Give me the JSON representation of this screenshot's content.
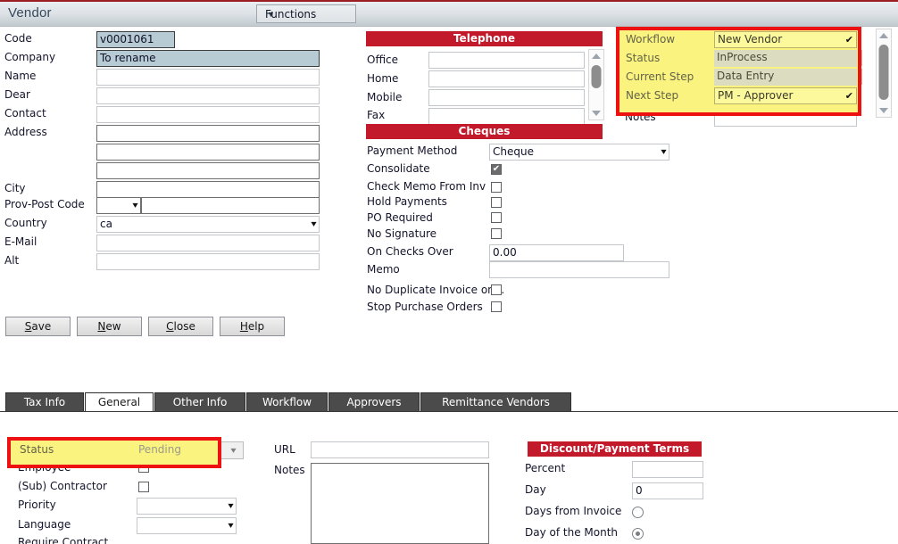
{
  "window": {
    "title": "Vendor",
    "functions_label": "Functions",
    "functions_caret": "▼",
    "accent_red": "#c2192b",
    "highlight_yellow": "#faf37f",
    "highlight_border": "#ee1111"
  },
  "vendor_form": {
    "fields": [
      {
        "label": "Code",
        "value": "v0001061",
        "state": "selected"
      },
      {
        "label": "Company",
        "value": "To rename",
        "state": "selected"
      },
      {
        "label": "Name",
        "value": "",
        "state": "normal"
      },
      {
        "label": "Dear",
        "value": "",
        "state": "normal"
      },
      {
        "label": "Contact",
        "value": "",
        "state": "normal"
      },
      {
        "label": "Address",
        "value": "",
        "state": "thick"
      },
      {
        "label": "",
        "value": "",
        "state": "thick"
      },
      {
        "label": "",
        "value": "",
        "state": "thick"
      },
      {
        "label": "City",
        "value": "",
        "state": "thick"
      },
      {
        "label": "Prov-Post Code",
        "value": "",
        "state": "split"
      },
      {
        "label": "Country",
        "value": "ca",
        "state": "select"
      },
      {
        "label": "E-Mail",
        "value": "",
        "state": "normal"
      },
      {
        "label": "Alt",
        "value": "",
        "state": "normal"
      }
    ],
    "prov_select_value": "",
    "postal_value": ""
  },
  "buttons": [
    {
      "label_pre": "",
      "accel": "S",
      "label_post": "ave",
      "name": "save-button"
    },
    {
      "label_pre": "",
      "accel": "N",
      "label_post": "ew",
      "name": "new-button"
    },
    {
      "label_pre": "",
      "accel": "C",
      "label_post": "lose",
      "name": "close-button"
    },
    {
      "label_pre": "",
      "accel": "H",
      "label_post": "elp",
      "name": "help-button"
    }
  ],
  "telephone": {
    "header": "Telephone",
    "rows": [
      {
        "label": "Office",
        "value": ""
      },
      {
        "label": "Home",
        "value": ""
      },
      {
        "label": "Mobile",
        "value": ""
      },
      {
        "label": "Fax",
        "value": ""
      }
    ]
  },
  "cheques": {
    "header": "Cheques",
    "payment_method_label": "Payment Method",
    "payment_method_value": "Cheque",
    "checkboxes": [
      {
        "label": "Consolidate",
        "checked": true
      },
      {
        "label": "Check Memo From Inv",
        "checked": false
      },
      {
        "label": "Hold Payments",
        "checked": false
      },
      {
        "label": "PO Required",
        "checked": false
      },
      {
        "label": "No Signature",
        "checked": false
      }
    ],
    "on_checks_over_label": "On Checks Over",
    "on_checks_over_value": "0.00",
    "memo_label": "Memo",
    "memo_value": "",
    "tail_checkboxes": [
      {
        "label": "No Duplicate Invoice on...",
        "checked": false
      },
      {
        "label": "Stop Purchase Orders",
        "checked": false
      }
    ]
  },
  "workflow_panel": {
    "rows": [
      {
        "label": "Workflow",
        "value": "New Vendor",
        "kind": "select"
      },
      {
        "label": "Status",
        "value": "InProcess",
        "kind": "readonly"
      },
      {
        "label": "Current Step",
        "value": "Data Entry",
        "kind": "readonly"
      },
      {
        "label": "Next Step",
        "value": "PM - Approver",
        "kind": "select"
      },
      {
        "label": "Notes",
        "value": "",
        "kind": "text"
      }
    ],
    "check_glyph": "✔"
  },
  "tabs": [
    {
      "label": "Tax Info",
      "active": false
    },
    {
      "label": "General",
      "active": true
    },
    {
      "label": "Other Info",
      "active": false
    },
    {
      "label": "Workflow",
      "active": false
    },
    {
      "label": "Approvers",
      "active": false
    },
    {
      "label": "Remittance Vendors",
      "active": false
    }
  ],
  "general_tab": {
    "status_label": "Status",
    "status_value": "Pending",
    "employee_label": "Employee",
    "employee_checked": false,
    "subcontractor_label": "(Sub) Contractor",
    "subcontractor_checked": false,
    "priority_label": "Priority",
    "priority_value": "",
    "language_label": "Language",
    "language_value": "",
    "require_contract_label": "Require Contract",
    "url_label": "URL",
    "url_value": "",
    "notes_label": "Notes",
    "notes_value": "",
    "discount": {
      "header": "Discount/Payment Terms",
      "percent_label": "Percent",
      "percent_value": "",
      "day_label": "Day",
      "day_value": "0",
      "days_from_invoice_label": "Days from Invoice",
      "days_from_invoice_selected": false,
      "day_of_month_label": "Day of the Month",
      "day_of_month_selected": true
    }
  }
}
